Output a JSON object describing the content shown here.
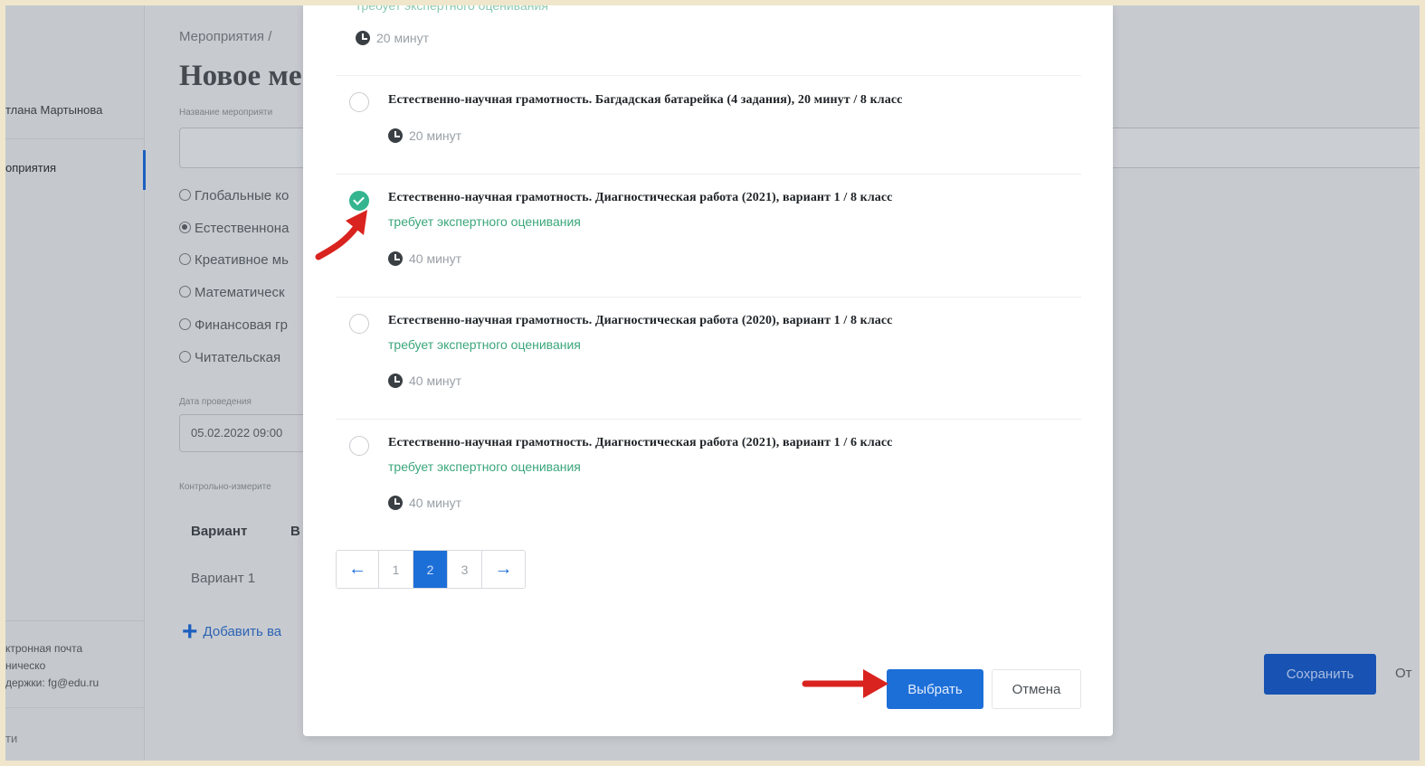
{
  "background": {
    "sidebar": {
      "user_name": "тлана Мартынова",
      "nav_item": "оприятия",
      "support_lines": [
        "ктронная почта",
        "ническо",
        "держки: fg@edu.ru"
      ],
      "footer_link": "ти",
      "collapse_glyph": ">"
    },
    "breadcrumb": "Мероприятия /",
    "page_title": "Новое ме",
    "event_name_label": "Название мероприяти",
    "radio_options": [
      {
        "label": "Глобальные ко",
        "checked": false
      },
      {
        "label": "Естественнона",
        "checked": true
      },
      {
        "label": "Креативное мь",
        "checked": false
      },
      {
        "label": "Математическ",
        "checked": false
      },
      {
        "label": "Финансовая гр",
        "checked": false
      },
      {
        "label": "Читательская",
        "checked": false
      }
    ],
    "date_label": "Дата проведения",
    "date_value": "05.02.2022 09:00",
    "kim_label": "Контрольно-измерите",
    "table_headers": [
      "Вариант",
      "В"
    ],
    "table_row": "Вариант 1",
    "add_label": "Добавить ва",
    "save_label": "Сохранить",
    "cancel_label": "От"
  },
  "modal": {
    "items": [
      {
        "title": "",
        "tag": "требует экспертного оценивания",
        "duration": "20 минут",
        "selected": false
      },
      {
        "title": "Естественно-научная грамотность. Багдадская батарейка (4 задания), 20 минут / 8 класс",
        "tag": "",
        "duration": "20 минут",
        "selected": false
      },
      {
        "title": "Естественно-научная грамотность. Диагностическая работа (2021), вариант 1 / 8 класс",
        "tag": "требует экспертного оценивания",
        "duration": "40 минут",
        "selected": true
      },
      {
        "title": "Естественно-научная грамотность. Диагностическая работа (2020), вариант 1 / 8 класс",
        "tag": "требует экспертного оценивания",
        "duration": "40 минут",
        "selected": false
      },
      {
        "title": "Естественно-научная грамотность. Диагностическая работа (2021), вариант 1 / 6 класс",
        "tag": "требует экспертного оценивания",
        "duration": "40 минут",
        "selected": false
      }
    ],
    "pagination": {
      "prev": "←",
      "pages": [
        "1",
        "2",
        "3"
      ],
      "active_page": "2",
      "next": "→"
    },
    "select_label": "Выбрать",
    "cancel_label": "Отмена"
  },
  "colors": {
    "primary": "#1d6fd8",
    "success": "#3aa67b",
    "annotation_arrow": "#d9231f"
  },
  "icons": [
    "clock-icon",
    "arrow-left-icon",
    "arrow-right-icon",
    "check-icon",
    "plus-icon"
  ]
}
